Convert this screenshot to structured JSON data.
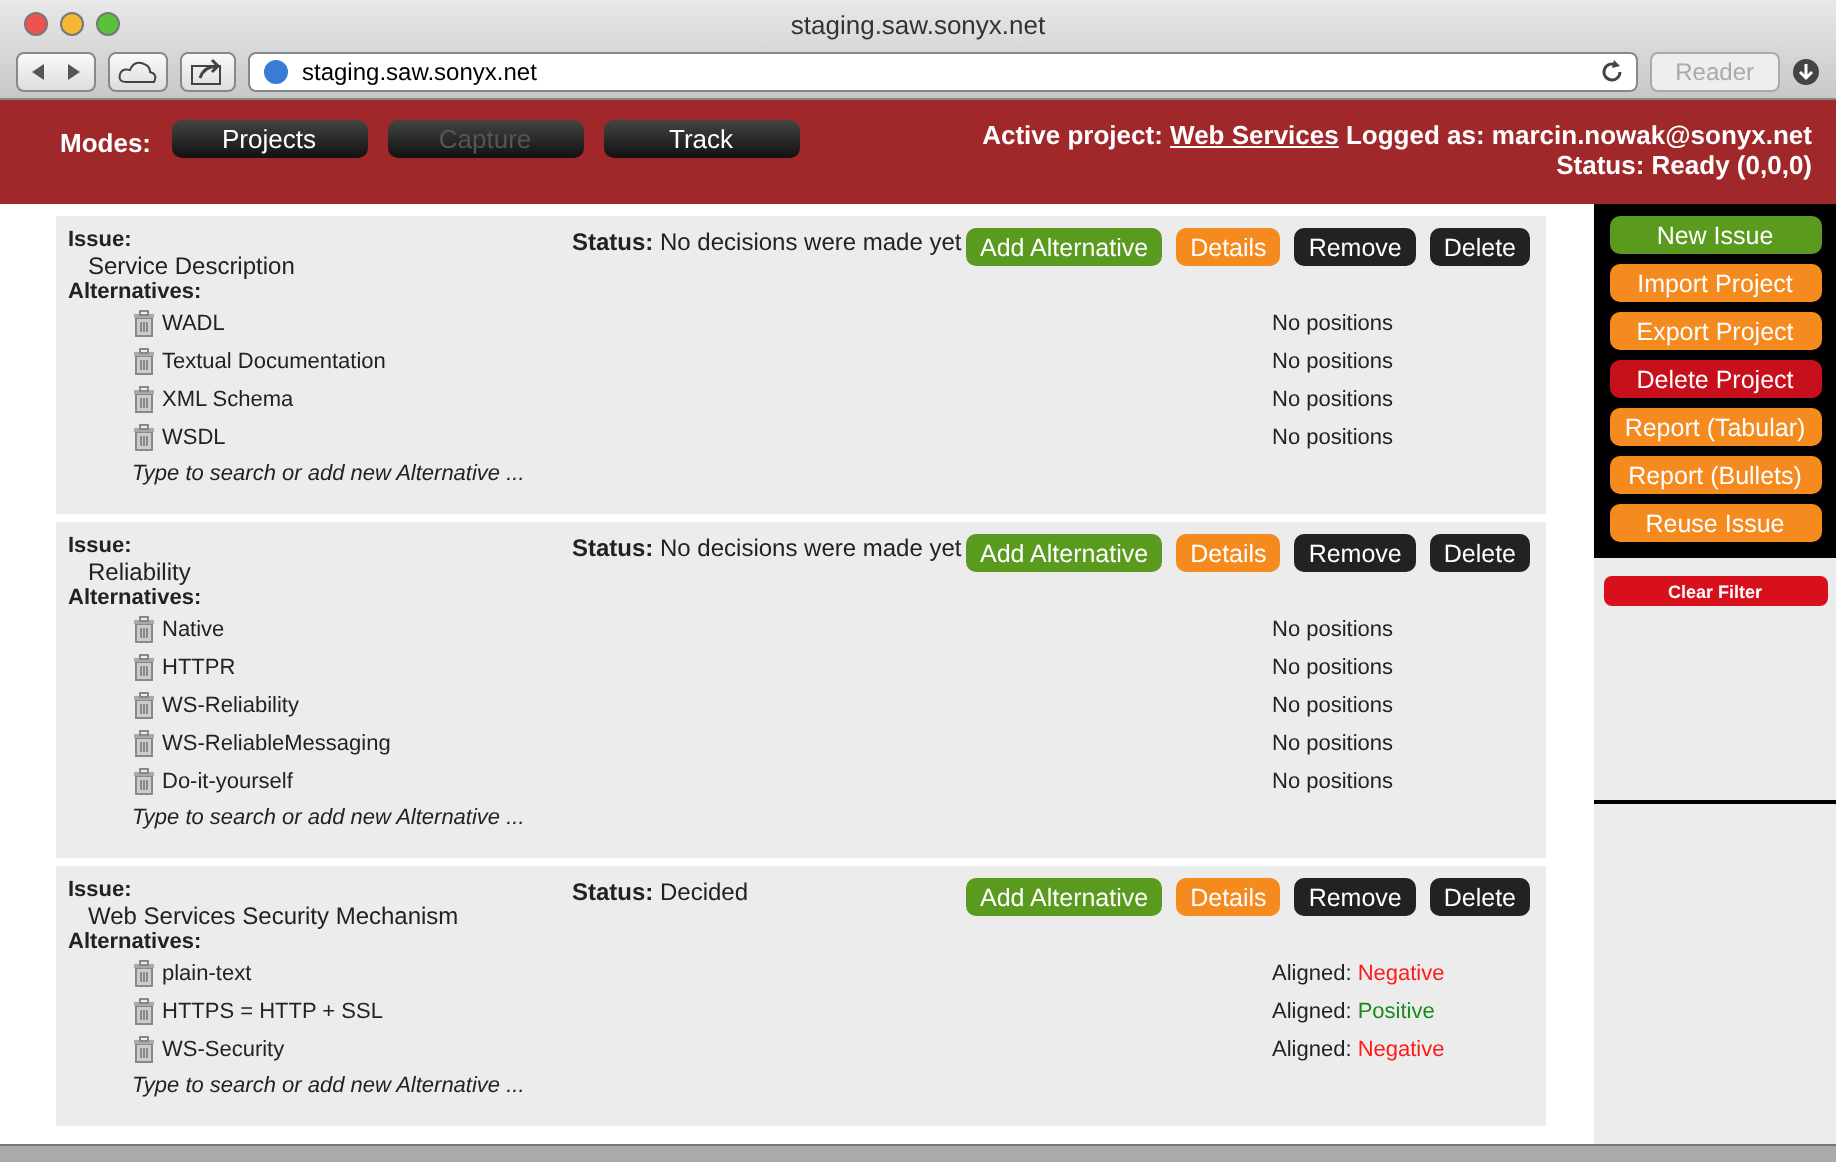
{
  "window": {
    "title": "staging.saw.sonyx.net"
  },
  "toolbar": {
    "url": "staging.saw.sonyx.net",
    "reader": "Reader"
  },
  "header": {
    "modes_label": "Modes:",
    "modes": [
      {
        "label": "Projects",
        "disabled": false
      },
      {
        "label": "Capture",
        "disabled": true
      },
      {
        "label": "Track",
        "disabled": false
      }
    ],
    "active_label": "Active project:",
    "project": "Web Services",
    "logged": "Logged as: marcin.nowak@sonyx.net",
    "status": "Status: Ready (0,0,0)"
  },
  "issues": [
    {
      "issue_label": "Issue:",
      "name": "Service Description",
      "status_label": "Status:",
      "status": "No decisions were made yet",
      "alternatives_label": "Alternatives:",
      "buttons": [
        {
          "label": "Add Alternative",
          "color": "#5a9a1e"
        },
        {
          "label": "Details",
          "color": "#f58a1f"
        },
        {
          "label": "Remove",
          "color": "#222222"
        },
        {
          "label": "Delete",
          "color": "#222222"
        }
      ],
      "alternatives": [
        {
          "name": "WADL",
          "position": "No positions"
        },
        {
          "name": "Textual Documentation",
          "position": "No positions"
        },
        {
          "name": "XML Schema",
          "position": "No positions"
        },
        {
          "name": "WSDL",
          "position": "No positions"
        }
      ],
      "placeholder": "Type to search or add new Alternative ..."
    },
    {
      "issue_label": "Issue:",
      "name": "Reliability",
      "status_label": "Status:",
      "status": "No decisions were made yet",
      "alternatives_label": "Alternatives:",
      "buttons": [
        {
          "label": "Add Alternative",
          "color": "#5a9a1e"
        },
        {
          "label": "Details",
          "color": "#f58a1f"
        },
        {
          "label": "Remove",
          "color": "#222222"
        },
        {
          "label": "Delete",
          "color": "#222222"
        }
      ],
      "alternatives": [
        {
          "name": "Native",
          "position": "No positions"
        },
        {
          "name": "HTTPR",
          "position": "No positions"
        },
        {
          "name": "WS-Reliability",
          "position": "No positions"
        },
        {
          "name": "WS-ReliableMessaging",
          "position": "No positions"
        },
        {
          "name": "Do-it-yourself",
          "position": "No positions"
        }
      ],
      "placeholder": "Type to search or add new Alternative ..."
    },
    {
      "issue_label": "Issue:",
      "name": "Web Services Security Mechanism",
      "status_label": "Status:",
      "status": "Decided",
      "alternatives_label": "Alternatives:",
      "buttons": [
        {
          "label": "Add Alternative",
          "color": "#5a9a1e"
        },
        {
          "label": "Details",
          "color": "#f58a1f"
        },
        {
          "label": "Remove",
          "color": "#222222"
        },
        {
          "label": "Delete",
          "color": "#222222"
        }
      ],
      "alternatives": [
        {
          "name": "plain-text",
          "position": "Aligned:",
          "value": "Negative",
          "color": "#ff1a1a"
        },
        {
          "name": "HTTPS = HTTP + SSL",
          "position": "Aligned:",
          "value": "Positive",
          "color": "#1a8a1a"
        },
        {
          "name": "WS-Security",
          "position": "Aligned:",
          "value": "Negative",
          "color": "#ff1a1a"
        }
      ],
      "placeholder": "Type to search or add new Alternative ..."
    }
  ],
  "sidebar": {
    "buttons": [
      {
        "label": "New Issue",
        "color": "#5a9a1e"
      },
      {
        "label": "Import Project",
        "color": "#f58a1f"
      },
      {
        "label": "Export Project",
        "color": "#f58a1f"
      },
      {
        "label": "Delete Project",
        "color": "#c8101c"
      },
      {
        "label": "Report (Tabular)",
        "color": "#f58a1f"
      },
      {
        "label": "Report (Bullets)",
        "color": "#f58a1f"
      },
      {
        "label": "Reuse Issue",
        "color": "#f58a1f"
      }
    ],
    "filter": {
      "label": "Clear Filter",
      "color": "#d8101c"
    }
  }
}
